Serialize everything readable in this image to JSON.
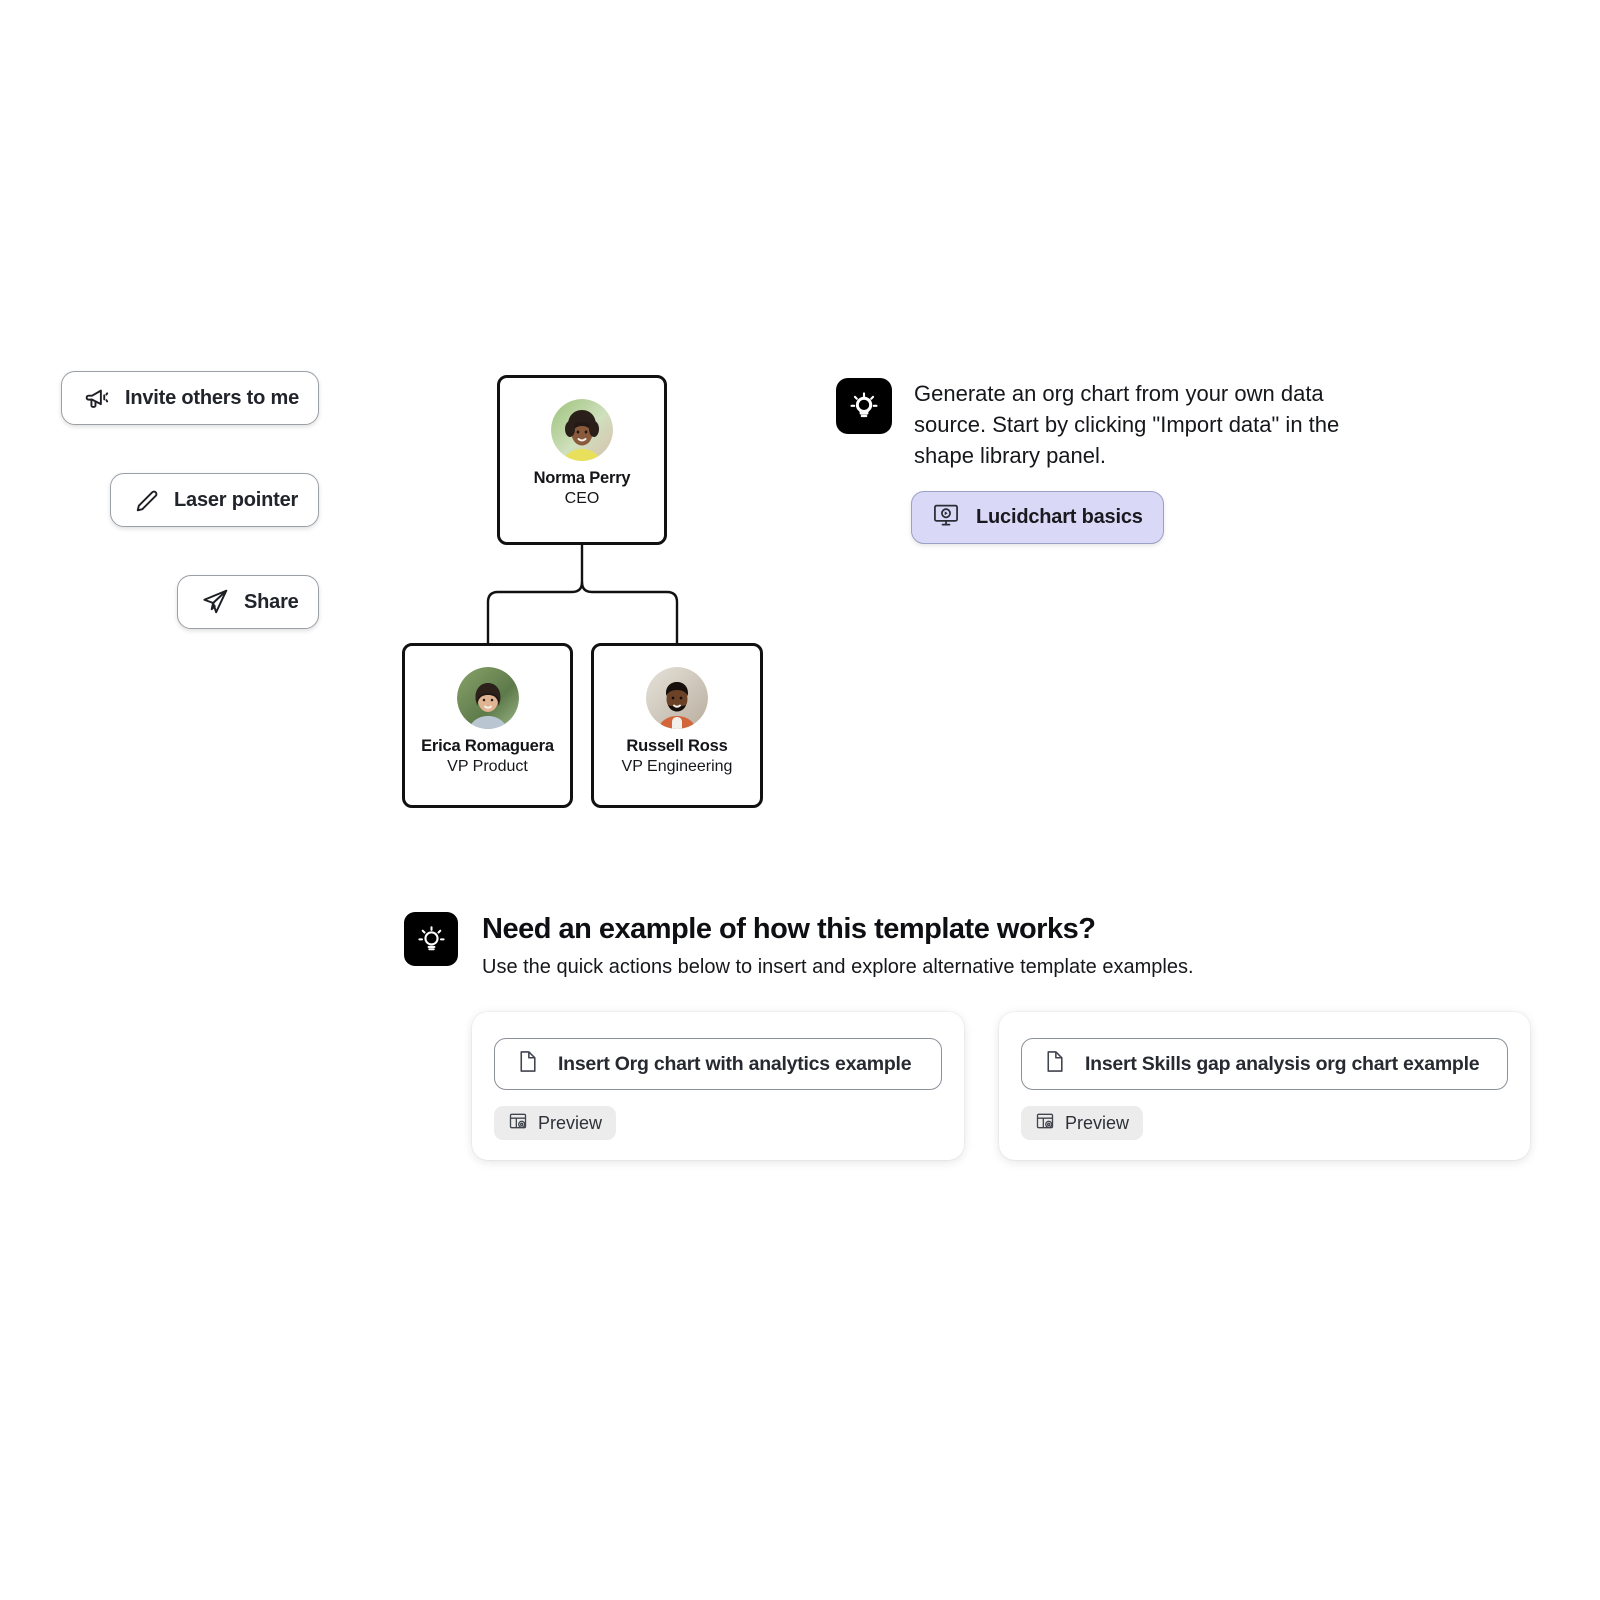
{
  "toolbar": {
    "invite": {
      "label": "Invite others to me",
      "icon": "megaphone-icon"
    },
    "laser": {
      "label": "Laser pointer",
      "icon": "pen-icon"
    },
    "share": {
      "label": "Share",
      "icon": "paper-plane-icon"
    }
  },
  "org_chart": {
    "nodes": [
      {
        "name": "Norma Perry",
        "title": "CEO"
      },
      {
        "name": "Erica Romaguera",
        "title": "VP Product"
      },
      {
        "name": "Russell Ross",
        "title": "VP Engineering"
      }
    ]
  },
  "tip": {
    "icon": "lightbulb-icon",
    "text": "Generate an org chart from your own data source. Start by clicking \"Import data\" in the shape library panel.",
    "button": {
      "label": "Lucidchart basics",
      "icon": "video-monitor-icon"
    }
  },
  "examples": {
    "icon": "lightbulb-icon",
    "title": "Need an example of how this template works?",
    "subtitle": "Use the quick actions below to insert and explore alternative template examples.",
    "cards": [
      {
        "insert_label": "Insert Org chart with analytics example",
        "insert_icon": "document-icon",
        "preview_label": "Preview",
        "preview_icon": "preview-layout-icon"
      },
      {
        "insert_label": "Insert Skills gap analysis org chart example",
        "insert_icon": "document-icon",
        "preview_label": "Preview",
        "preview_icon": "preview-layout-icon"
      }
    ]
  },
  "colors": {
    "accent_lavender": "#d9d9f7",
    "badge_black": "#000000",
    "node_border": "#111111",
    "chip_gray": "#ececec"
  }
}
